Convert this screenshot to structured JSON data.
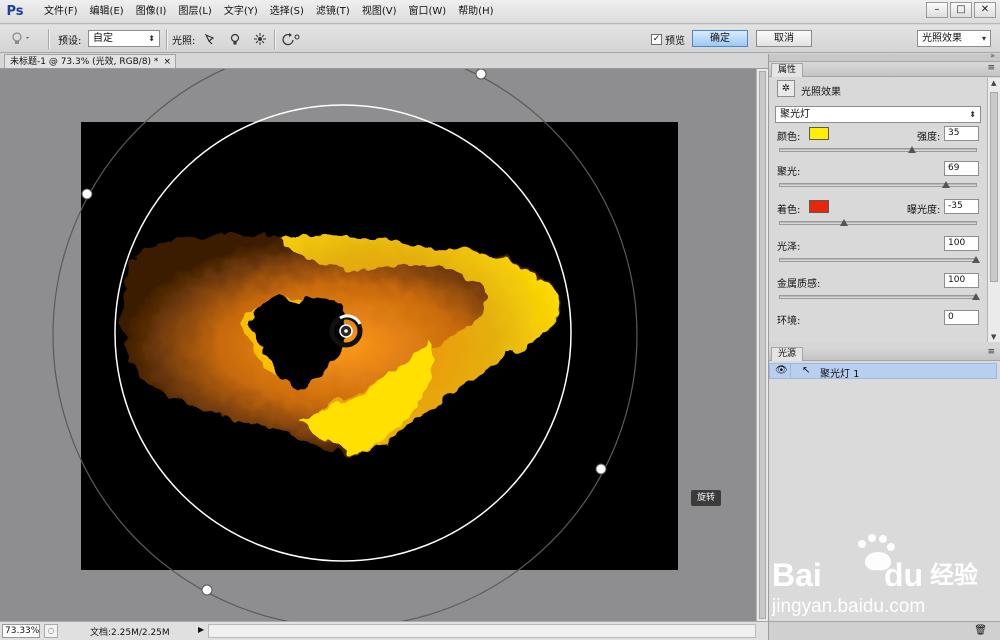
{
  "app": {
    "logo": "Ps"
  },
  "menu": [
    "文件(F)",
    "编辑(E)",
    "图像(I)",
    "图层(L)",
    "文字(Y)",
    "选择(S)",
    "滤镜(T)",
    "视图(V)",
    "窗口(W)",
    "帮助(H)"
  ],
  "options": {
    "preset_label": "预设:",
    "preset_value": "自定",
    "lights_label": "光照:",
    "preview_label": "预览",
    "preview_checked": true,
    "ok_label": "确定",
    "cancel_label": "取消",
    "workspace_value": "光照效果"
  },
  "document": {
    "tab_title": "未标题-1 @ 73.3% (光效, RGB/8) *",
    "tooltip": "旋转"
  },
  "status": {
    "zoom": "73.33%",
    "doc_info": "文档:2.25M/2.25M"
  },
  "properties": {
    "tab": "属性",
    "effect_title": "光照效果",
    "light_type": "聚光灯",
    "color_label": "颜色:",
    "color_hex": "#ffee00",
    "intensity_label": "强度:",
    "intensity": "35",
    "hotspot_label": "聚光:",
    "hotspot": "69",
    "colorize_label": "着色:",
    "colorize_hex": "#e8260e",
    "exposure_label": "曝光度:",
    "exposure": "-35",
    "gloss_label": "光泽:",
    "gloss": "100",
    "metallic_label": "金属质感:",
    "metallic": "100",
    "ambience_label": "环境:",
    "ambience": "0"
  },
  "lights_panel": {
    "tab": "光源",
    "items": [
      {
        "name": "聚光灯 1",
        "selected": true
      }
    ]
  },
  "watermark": {
    "brand_left": "Bai",
    "brand_right": "du",
    "brand_cn": "经验",
    "url": "jingyan.baidu.com"
  }
}
